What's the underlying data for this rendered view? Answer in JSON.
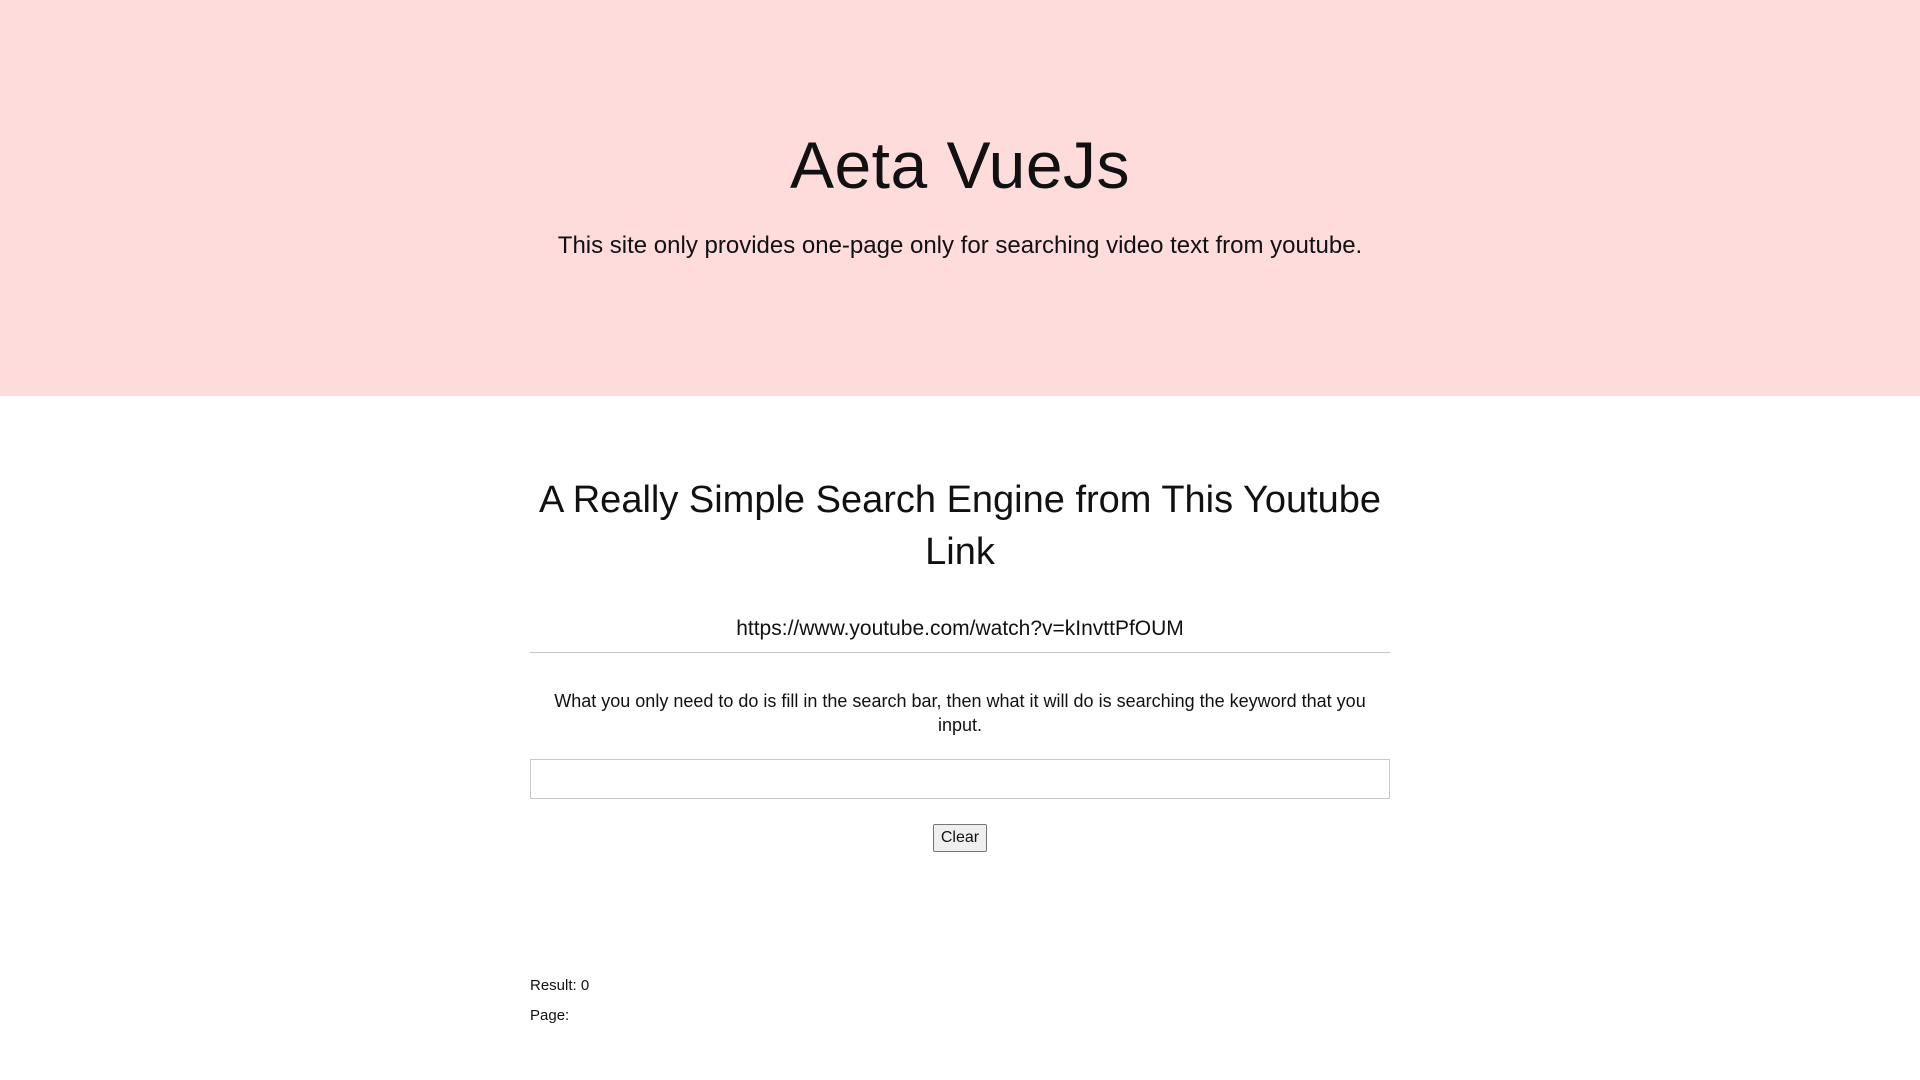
{
  "hero": {
    "title": "Aeta VueJs",
    "subtitle": "This site only provides one-page only for searching video text from youtube."
  },
  "main": {
    "heading": "A Really Simple Search Engine from This Youtube Link",
    "youtube_link": "https://www.youtube.com/watch?v=kInvttPfOUM",
    "hint": "What you only need to do is fill in the search bar, then what it will do is searching the keyword that you input.",
    "search": {
      "value": "",
      "placeholder": ""
    },
    "clear_label": "Clear"
  },
  "results": {
    "result_label": "Result:",
    "result_count": "0",
    "page_label": "Page:"
  },
  "colors": {
    "hero_background": "#ffdcdc",
    "page_background": "#ffffff",
    "text": "#111111"
  }
}
